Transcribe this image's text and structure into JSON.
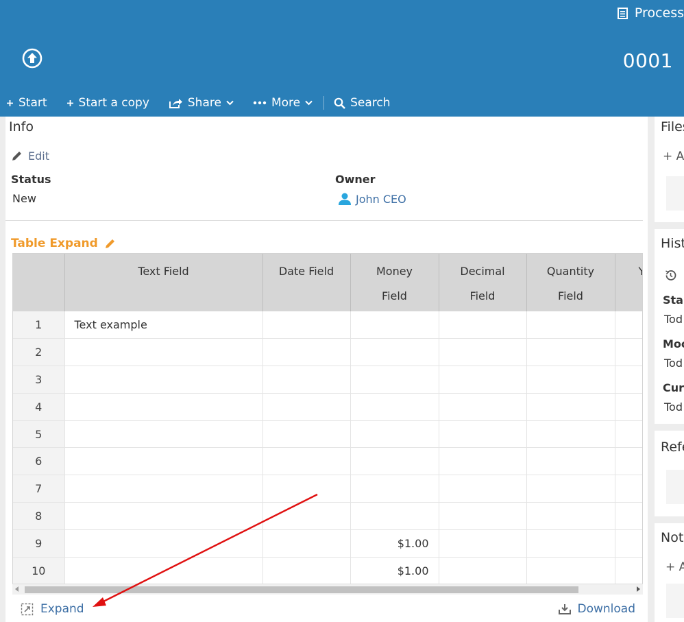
{
  "header": {
    "process_label": "Process",
    "record_number": "0001",
    "toolbar": {
      "start": "Start",
      "start_copy": "Start a copy",
      "share": "Share",
      "more": "More",
      "search": "Search"
    }
  },
  "info": {
    "title": "Info",
    "edit_label": "Edit",
    "status_label": "Status",
    "status_value": "New",
    "owner_label": "Owner",
    "owner_value": "John CEO"
  },
  "table_expand": {
    "title": "Table Expand",
    "columns": [
      {
        "line1": "",
        "line2": ""
      },
      {
        "line1": "Text Field",
        "line2": ""
      },
      {
        "line1": "Date Field",
        "line2": ""
      },
      {
        "line1": "Money",
        "line2": "Field"
      },
      {
        "line1": "Decimal",
        "line2": "Field"
      },
      {
        "line1": "Quantity",
        "line2": "Field"
      },
      {
        "line1": "Y",
        "line2": ""
      }
    ],
    "rows": [
      {
        "n": "1",
        "text": "Text example",
        "date": "",
        "money": "",
        "decimal": "",
        "quantity": ""
      },
      {
        "n": "2",
        "text": "",
        "date": "",
        "money": "",
        "decimal": "",
        "quantity": ""
      },
      {
        "n": "3",
        "text": "",
        "date": "",
        "money": "",
        "decimal": "",
        "quantity": ""
      },
      {
        "n": "4",
        "text": "",
        "date": "",
        "money": "",
        "decimal": "",
        "quantity": ""
      },
      {
        "n": "5",
        "text": "",
        "date": "",
        "money": "",
        "decimal": "",
        "quantity": ""
      },
      {
        "n": "6",
        "text": "",
        "date": "",
        "money": "",
        "decimal": "",
        "quantity": ""
      },
      {
        "n": "7",
        "text": "",
        "date": "",
        "money": "",
        "decimal": "",
        "quantity": ""
      },
      {
        "n": "8",
        "text": "",
        "date": "",
        "money": "",
        "decimal": "",
        "quantity": ""
      },
      {
        "n": "9",
        "text": "",
        "date": "",
        "money": "$1.00",
        "decimal": "",
        "quantity": ""
      },
      {
        "n": "10",
        "text": "",
        "date": "",
        "money": "$1.00",
        "decimal": "",
        "quantity": ""
      }
    ],
    "expand_label": "Expand",
    "download_label": "Download"
  },
  "right": {
    "files_title": "Files",
    "files_add": "+ A",
    "history_title": "Hist",
    "history_items": [
      {
        "label": "Star",
        "value": "Tod"
      },
      {
        "label": "Moc",
        "value": "Tod"
      },
      {
        "label": "Cur",
        "value": "Tod"
      }
    ],
    "references_title": "Refe",
    "notes_title": "Not",
    "notes_add": "+ A"
  },
  "colors": {
    "header_bg": "#2a7fb8",
    "accent_orange": "#f09a2a",
    "link_blue": "#3d6fa5",
    "annotation_red": "#e01010"
  }
}
